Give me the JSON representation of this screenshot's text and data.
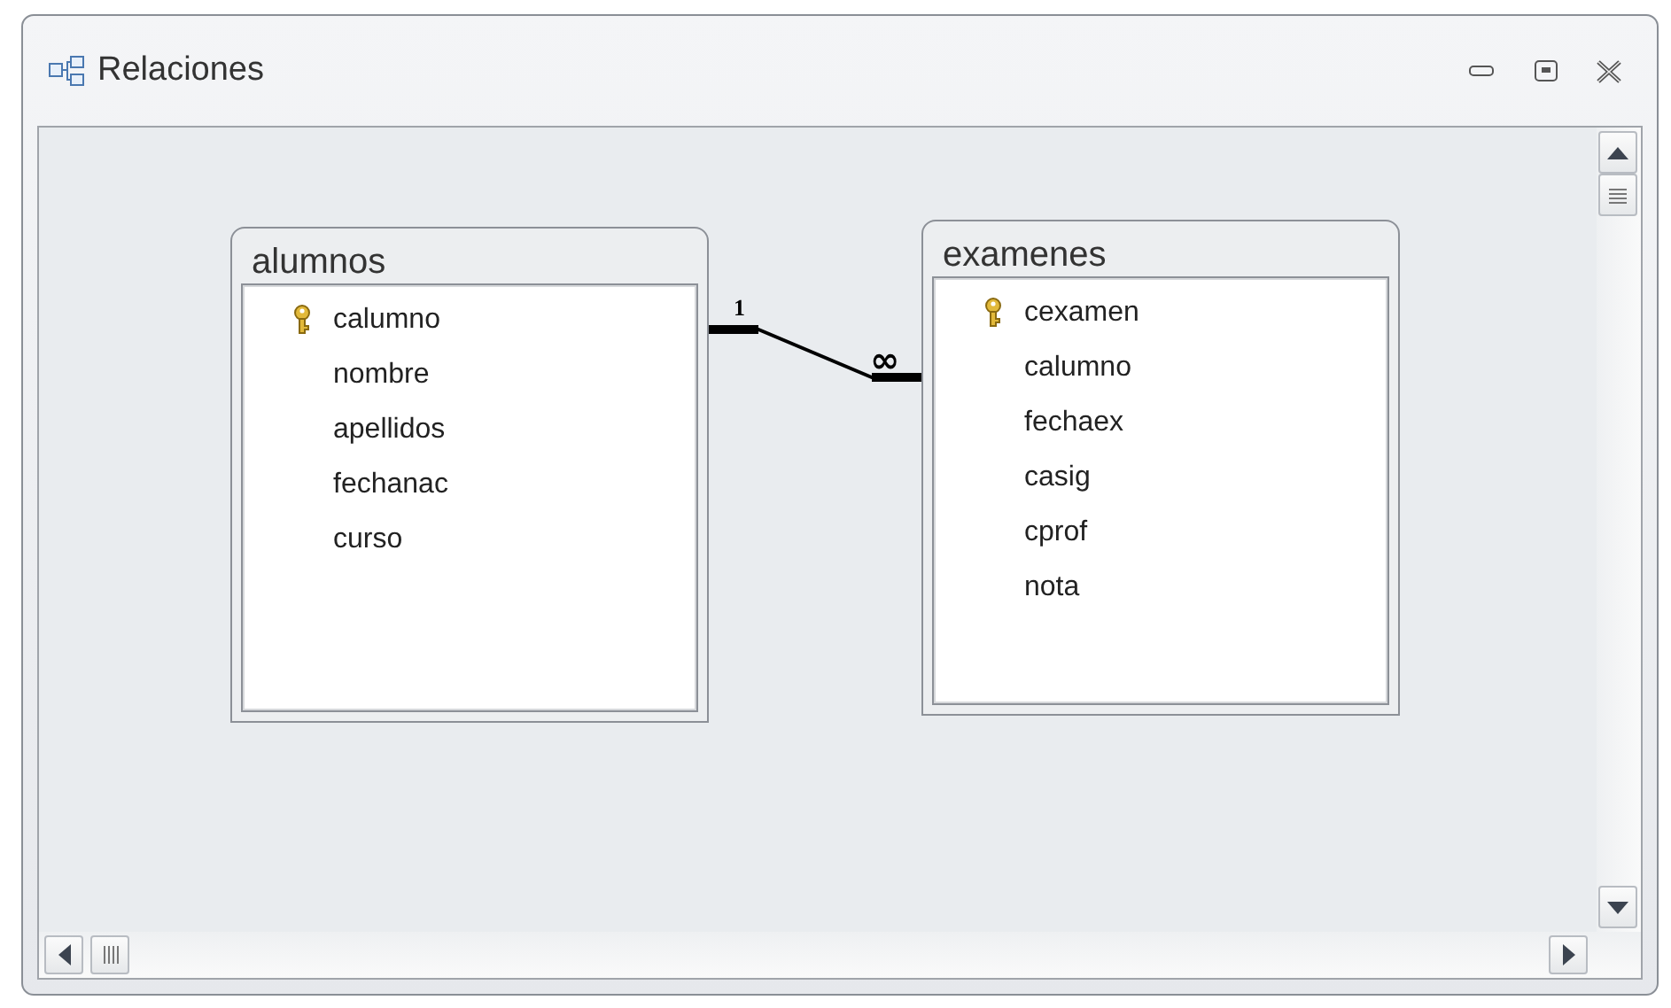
{
  "window": {
    "title": "Relaciones"
  },
  "tables": [
    {
      "name": "alumnos",
      "fields": [
        {
          "name": "calumno",
          "primary_key": true
        },
        {
          "name": "nombre",
          "primary_key": false
        },
        {
          "name": "apellidos",
          "primary_key": false
        },
        {
          "name": "fechanac",
          "primary_key": false
        },
        {
          "name": "curso",
          "primary_key": false
        }
      ]
    },
    {
      "name": "examenes",
      "fields": [
        {
          "name": "cexamen",
          "primary_key": true
        },
        {
          "name": "calumno",
          "primary_key": false
        },
        {
          "name": "fechaex",
          "primary_key": false
        },
        {
          "name": "casig",
          "primary_key": false
        },
        {
          "name": "cprof",
          "primary_key": false
        },
        {
          "name": "nota",
          "primary_key": false
        }
      ]
    }
  ],
  "relationship": {
    "one_label": "1",
    "many_label": "∞"
  }
}
